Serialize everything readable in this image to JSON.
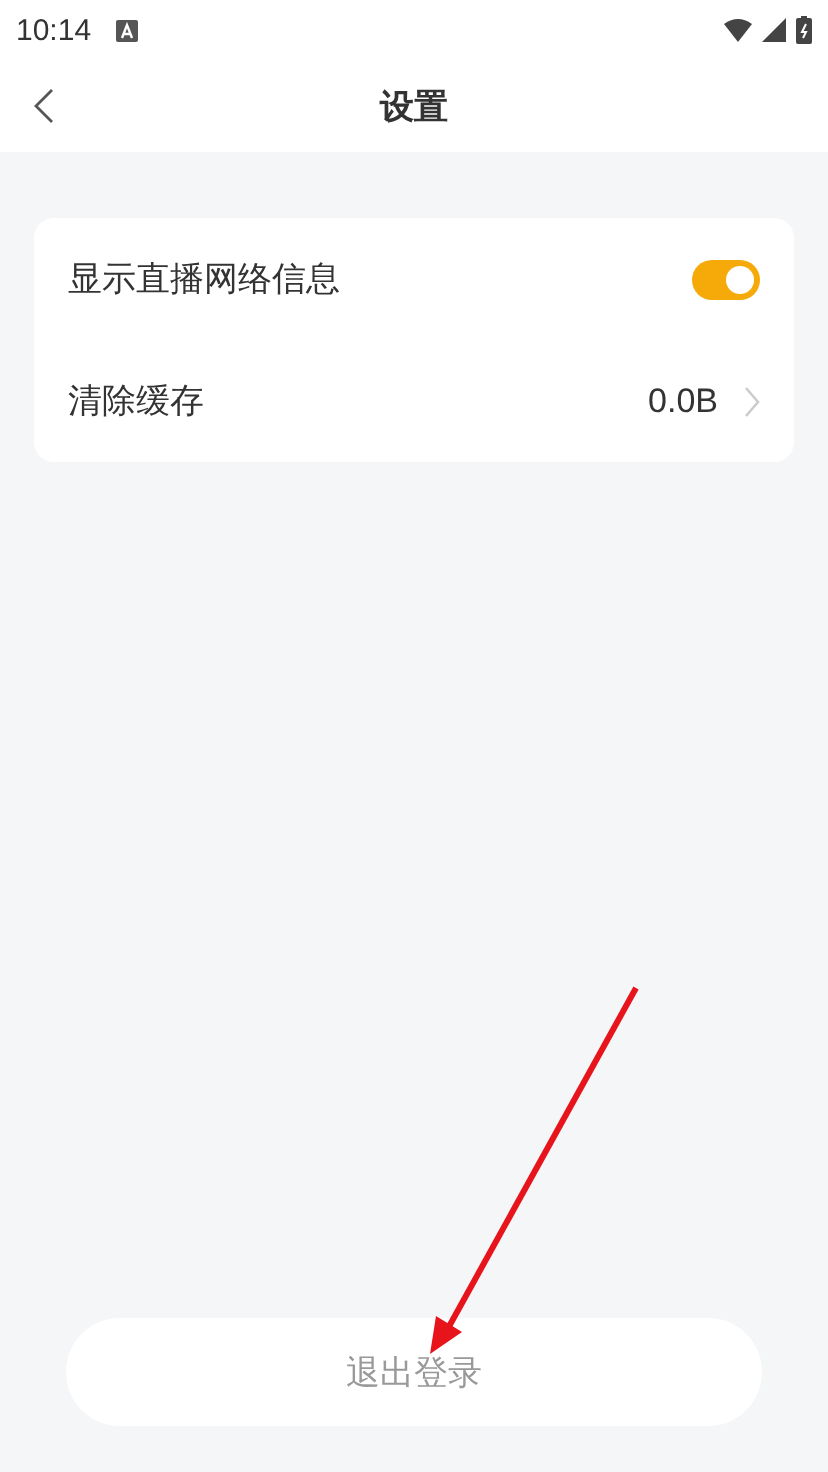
{
  "status_bar": {
    "time": "10:14"
  },
  "header": {
    "title": "设置"
  },
  "settings": [
    {
      "kind": "toggle",
      "label": "显示直播网络信息",
      "on": true
    },
    {
      "kind": "link",
      "label": "清除缓存",
      "value": "0.0B"
    }
  ],
  "logout_button": {
    "label": "退出登录"
  },
  "annotation": {
    "kind": "arrow",
    "color": "#e8141b"
  }
}
